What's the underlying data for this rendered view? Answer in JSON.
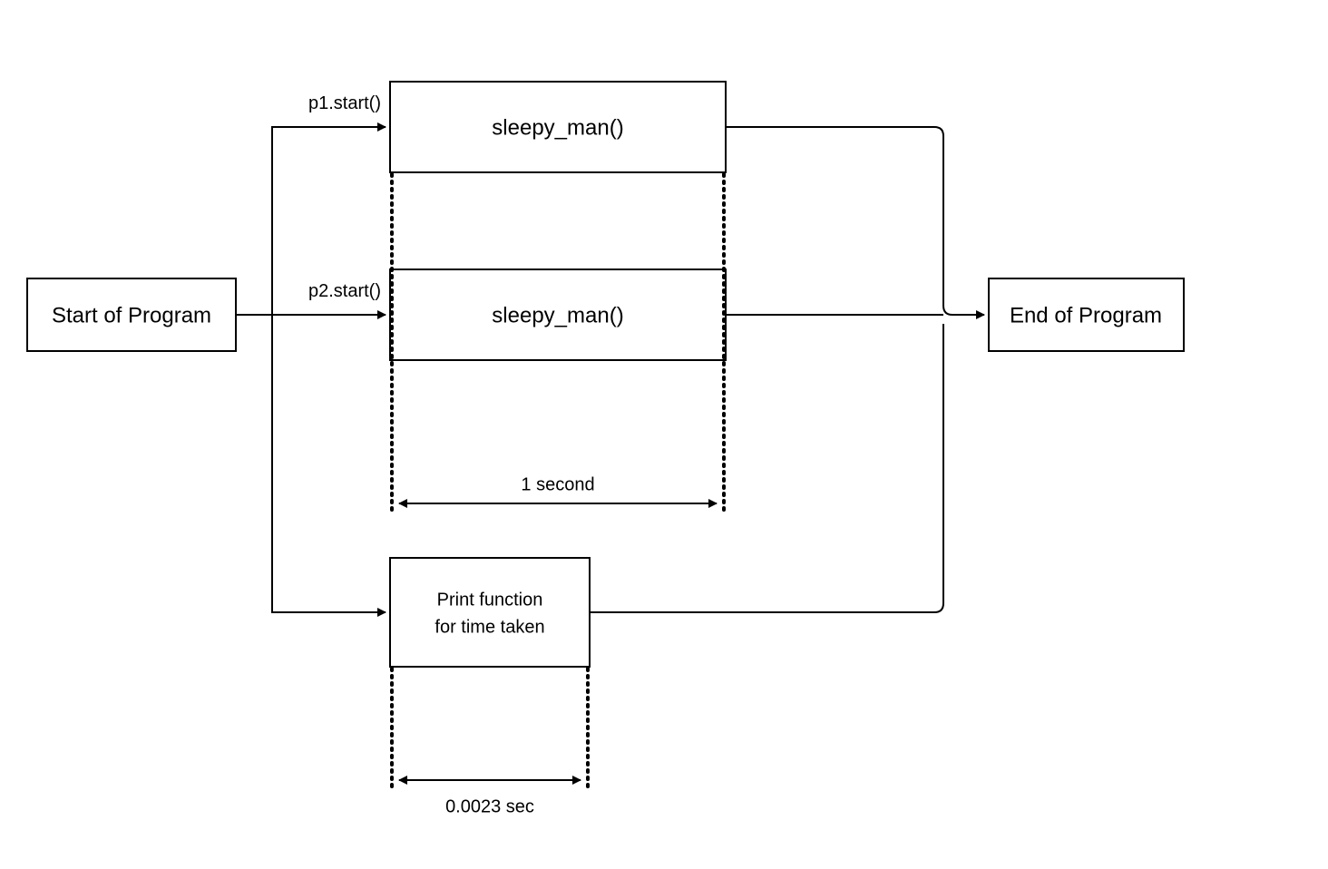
{
  "nodes": {
    "start": "Start of Program",
    "end": "End of Program",
    "sleepy1": "sleepy_man()",
    "sleepy2": "sleepy_man()",
    "print_line1": "Print function",
    "print_line2": "for time taken"
  },
  "edges": {
    "p1": "p1.start()",
    "p2": "p2.start()"
  },
  "durations": {
    "long": "1 second",
    "short": "0.0023 sec"
  }
}
